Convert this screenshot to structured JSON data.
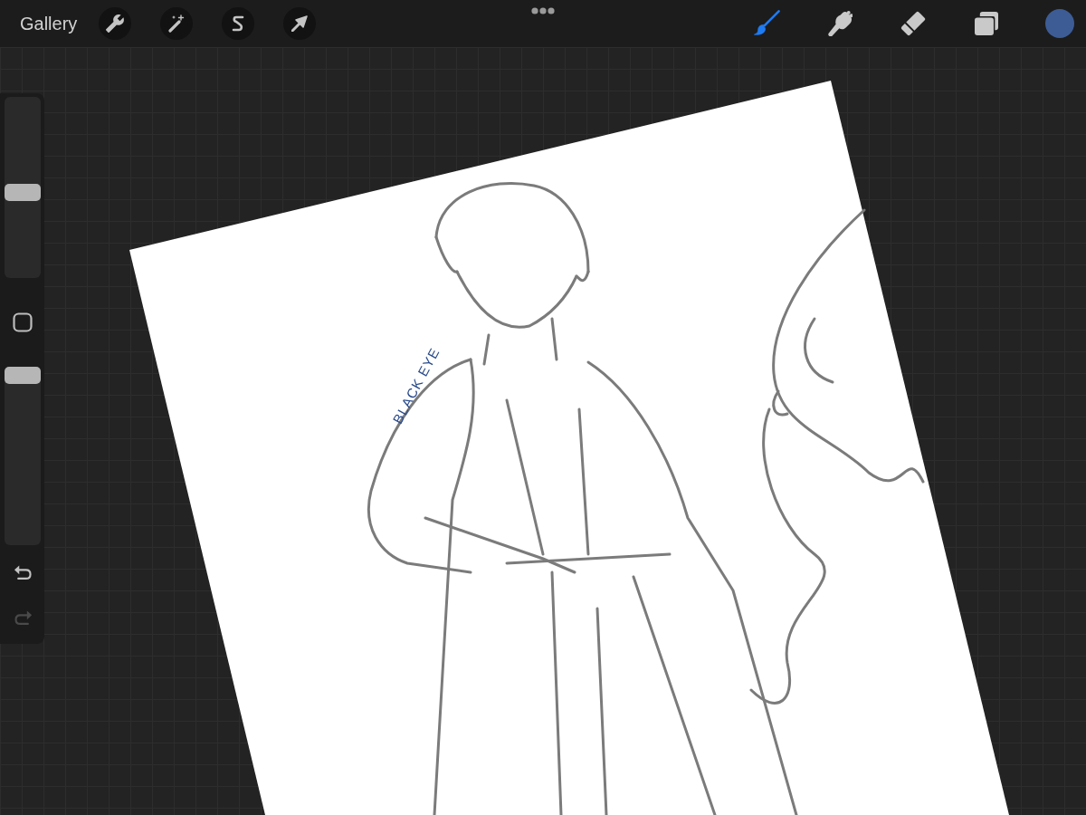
{
  "top_bar": {
    "gallery": "Gallery",
    "actions": [
      {
        "kind": "wrench"
      },
      {
        "kind": "magic-wand"
      },
      {
        "kind": "selection"
      },
      {
        "kind": "transform"
      }
    ],
    "tools": [
      {
        "kind": "brush",
        "selected": true
      },
      {
        "kind": "smudge",
        "selected": false
      },
      {
        "kind": "eraser",
        "selected": false
      },
      {
        "kind": "layers",
        "selected": false
      }
    ],
    "color_swatch": {
      "color": "#3d5c96"
    }
  },
  "sidebar": {
    "brush_size": {
      "level": 0.47
    },
    "opacity": {
      "level": 1
    },
    "undo": {
      "disabled": false
    },
    "redo": {
      "disabled": true
    }
  },
  "canvas": {
    "handwritten_text": "BLACK EYE"
  }
}
